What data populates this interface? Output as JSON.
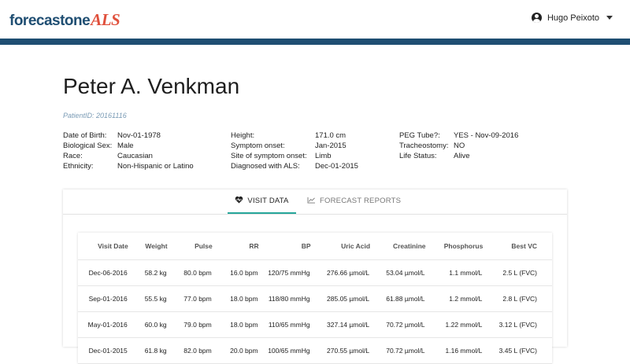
{
  "app": {
    "logo_part1": "forecastone",
    "logo_part2": "ALS",
    "user_name": "Hugo Peixoto",
    "accent_color": "#1f4e72",
    "tab_indicator_color": "#26a69a"
  },
  "patient": {
    "name": "Peter A. Venkman",
    "id_label": "PatientID: 20161116",
    "col1": [
      {
        "label": "Date of Birth:",
        "value": "Nov-01-1978"
      },
      {
        "label": "Biological Sex:",
        "value": "Male"
      },
      {
        "label": "Race:",
        "value": "Caucasian"
      },
      {
        "label": "Ethnicity:",
        "value": "Non-Hispanic or Latino"
      }
    ],
    "col2": [
      {
        "label": "Height:",
        "value": "171.0 cm"
      },
      {
        "label": "Symptom onset:",
        "value": "Jan-2015"
      },
      {
        "label": "Site of symptom onset:",
        "value": "Limb"
      },
      {
        "label": "Diagnosed with ALS:",
        "value": "Dec-01-2015"
      }
    ],
    "col3": [
      {
        "label": "PEG Tube?:",
        "value": "YES - Nov-09-2016"
      },
      {
        "label": "Tracheostomy:",
        "value": "NO"
      },
      {
        "label": "Life Status:",
        "value": "Alive"
      }
    ]
  },
  "tabs": [
    {
      "label": "VISIT DATA",
      "icon": "heart-pulse-icon",
      "active": true
    },
    {
      "label": "FORECAST REPORTS",
      "icon": "line-chart-icon",
      "active": false
    }
  ],
  "table": {
    "headers": [
      "Visit Date",
      "Weight",
      "Pulse",
      "RR",
      "BP",
      "Uric Acid",
      "Creatinine",
      "Phosphorus",
      "Best VC"
    ],
    "rows": [
      [
        "Dec-06-2016",
        "58.2 kg",
        "80.0 bpm",
        "16.0 bpm",
        "120/75 mmHg",
        "276.66 µmol/L",
        "53.04 µmol/L",
        "1.1 mmol/L",
        "2.5 L (FVC)"
      ],
      [
        "Sep-01-2016",
        "55.5 kg",
        "77.0 bpm",
        "18.0 bpm",
        "118/80 mmHg",
        "285.05 µmol/L",
        "61.88 µmol/L",
        "1.2 mmol/L",
        "2.8 L (FVC)"
      ],
      [
        "May-01-2016",
        "60.0 kg",
        "79.0 bpm",
        "18.0 bpm",
        "110/65 mmHg",
        "327.14 µmol/L",
        "70.72 µmol/L",
        "1.22 mmol/L",
        "3.12 L (FVC)"
      ],
      [
        "Dec-01-2015",
        "61.8 kg",
        "82.0 bpm",
        "20.0 bpm",
        "100/65 mmHg",
        "270.55 µmol/L",
        "70.72 µmol/L",
        "1.16 mmol/L",
        "3.45 L (FVC)"
      ]
    ]
  }
}
